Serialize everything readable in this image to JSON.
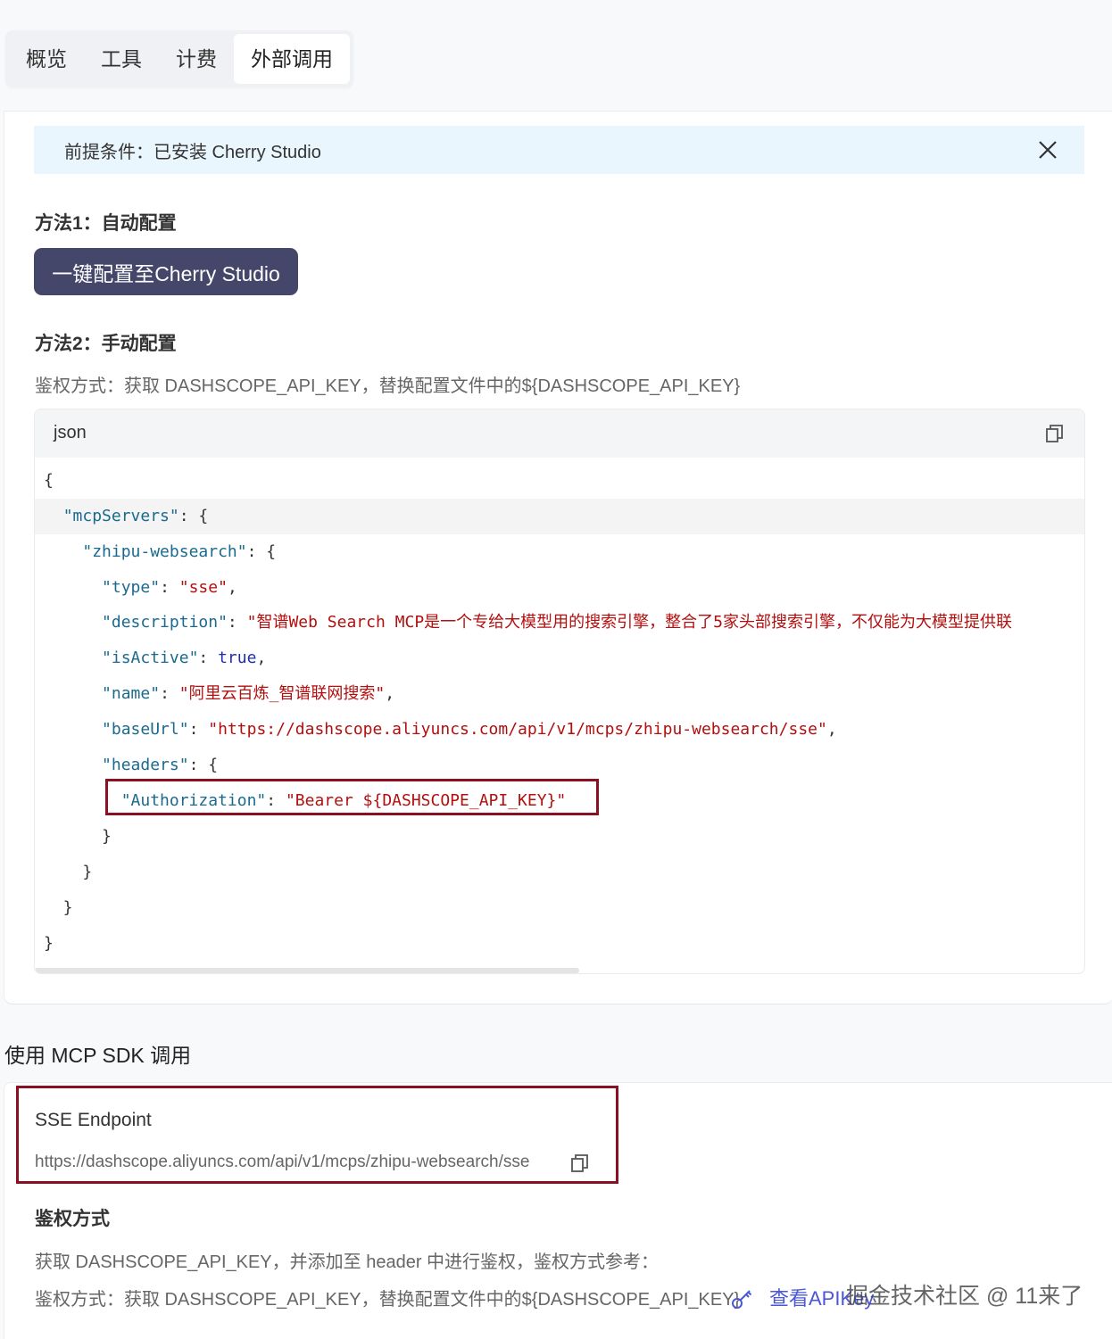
{
  "tabs": [
    "概览",
    "工具",
    "计费",
    "外部调用"
  ],
  "notice": {
    "text": "前提条件：已安装 Cherry Studio"
  },
  "method1": {
    "title": "方法1：自动配置",
    "button": "一键配置至Cherry Studio"
  },
  "method2": {
    "title": "方法2：手动配置",
    "auth_desc": "鉴权方式：获取 DASHSCOPE_API_KEY，替换配置文件中的${DASHSCOPE_API_KEY}"
  },
  "code": {
    "lang": "json",
    "lines": [
      "{",
      "  \"mcpServers\": {",
      "    \"zhipu-websearch\": {",
      "      \"type\": \"sse\",",
      "      \"description\": \"智谱Web Search MCP是一个专给大模型用的搜索引擎，整合了5家头部搜索引擎，不仅能为大模型提供联",
      "      \"isActive\": true,",
      "      \"name\": \"阿里云百炼_智谱联网搜索\",",
      "      \"baseUrl\": \"https://dashscope.aliyuncs.com/api/v1/mcps/zhipu-websearch/sse\",",
      "      \"headers\": {",
      "        \"Authorization\": \"Bearer ${DASHSCOPE_API_KEY}\"",
      "      }",
      "    }",
      "  }",
      "}"
    ]
  },
  "sdk": {
    "title": "使用 MCP SDK 调用",
    "sse_label": "SSE Endpoint",
    "sse_url": "https://dashscope.aliyuncs.com/api/v1/mcps/zhipu-websearch/sse",
    "auth_title": "鉴权方式",
    "auth_text": "获取 DASHSCOPE_API_KEY，并添加至 header 中进行鉴权，鉴权方式参考：",
    "auth_desc": "鉴权方式：获取 DASHSCOPE_API_KEY，替换配置文件中的${DASHSCOPE_API_KEY}",
    "link": "查看API",
    "link_suffix": "Key"
  },
  "watermark": "掘金技术社区 @ 11来了"
}
